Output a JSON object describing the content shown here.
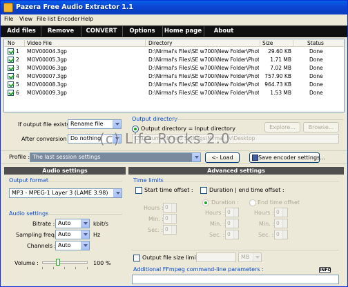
{
  "window": {
    "title": "Pazera Free Audio Extractor 1.1"
  },
  "menu": [
    "File",
    "View",
    "File list",
    "Encoder",
    "Help"
  ],
  "toolbar": [
    "Add files",
    "Remove",
    "CONVERT",
    "Options",
    "Home page",
    "About"
  ],
  "filelist": {
    "headers": {
      "no": "No",
      "video": "Video File",
      "dir": "Directory",
      "size": "Size",
      "status": "Status"
    },
    "rows": [
      {
        "no": "1",
        "file": "MOV00004.3gp",
        "dir": "D:\\Nirmal's Files\\SE w700i\\New Folder\\Photo...",
        "size": "29.60 KB",
        "status": "Done"
      },
      {
        "no": "2",
        "file": "MOV00005.3gp",
        "dir": "D:\\Nirmal's Files\\SE w700i\\New Folder\\Photo...",
        "size": "1.71 MB",
        "status": "Done"
      },
      {
        "no": "3",
        "file": "MOV00006.3gp",
        "dir": "D:\\Nirmal's Files\\SE w700i\\New Folder\\Photo...",
        "size": "7.02 MB",
        "status": "Done"
      },
      {
        "no": "4",
        "file": "MOV00007.3gp",
        "dir": "D:\\Nirmal's Files\\SE w700i\\New Folder\\Photo...",
        "size": "757.90 KB",
        "status": "Done"
      },
      {
        "no": "5",
        "file": "MOV00008.3gp",
        "dir": "D:\\Nirmal's Files\\SE w700i\\New Folder\\Photo...",
        "size": "964.73 KB",
        "status": "Done"
      },
      {
        "no": "6",
        "file": "MOV00009.3gp",
        "dir": "D:\\Nirmal's Files\\SE w700i\\New Folder\\Photo...",
        "size": "1.53 MB",
        "status": "Done"
      }
    ]
  },
  "options": {
    "if_exists_label": "If output file exists :",
    "if_exists_value": "Rename file",
    "after_label": "After conversion :",
    "after_value": "Do nothing"
  },
  "output_dir": {
    "header": "Output directory",
    "radio_label": "Output directory = Input directory",
    "explore": "Explore...",
    "browse": "Browse...",
    "path": "C:\\Documents and Settings\\Nirmal_tv\\Desktop"
  },
  "profile": {
    "label": "Profile :",
    "value": "The last session settings",
    "load": "<- Load",
    "save": "Save encoder settings..."
  },
  "audio": {
    "header": "Audio settings",
    "format_group": "Output format",
    "format_value": "MP3 - MPEG-1 Layer 3 (LAME 3.98)",
    "settings_group": "Audio settings",
    "bitrate_label": "Bitrate :",
    "bitrate_value": "Auto",
    "bitrate_unit": "kbit/s",
    "sampling_label": "Sampling freq. :",
    "sampling_value": "Auto",
    "sampling_unit": "Hz",
    "channels_label": "Channels :",
    "channels_value": "Auto",
    "volume_label": "Volume :",
    "volume_value": "100 %",
    "volume_level": 0.33
  },
  "advanced": {
    "header": "Advanced settings",
    "time_limits": "Time limits",
    "start_label": "Start time offset :",
    "duration_label": "Duration | end time offset :",
    "hours": "Hours :",
    "min": "Min. :",
    "sec": "Sec. :",
    "duration_radio": "Duration :",
    "end_radio": "End time offset",
    "spin_value": "0",
    "size_limit_label": "Output file size limit :",
    "size_unit": "MB",
    "ffmpeg_label": "Additional FFmpeg command-line parameters :",
    "info": "INFO"
  },
  "watermark": "(c) Life Rocks 2.0"
}
